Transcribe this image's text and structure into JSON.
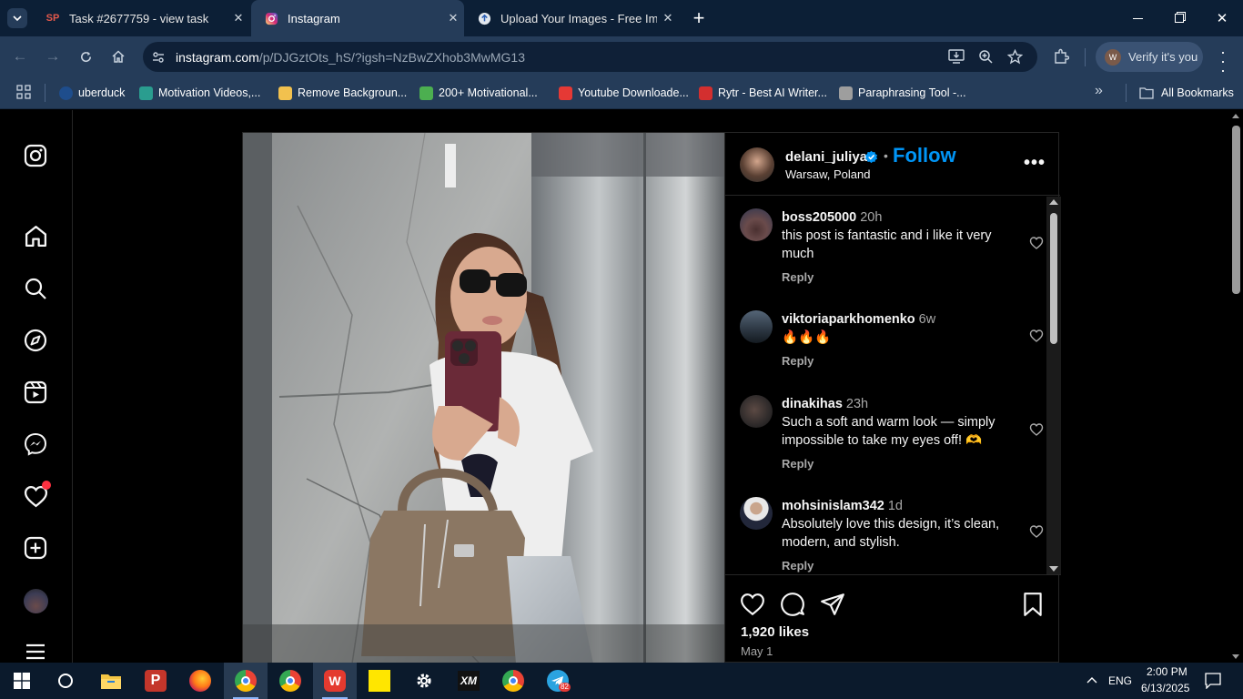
{
  "browser": {
    "tabs": [
      {
        "title": "Task #2677759 - view task",
        "favicon": "SP",
        "active": false
      },
      {
        "title": "Instagram",
        "favicon": "instagram-icon",
        "active": true
      },
      {
        "title": "Upload Your Images - Free Imag",
        "favicon": "upload-icon",
        "active": false
      }
    ],
    "url_host": "instagram.com",
    "url_path": "/p/DJGztOts_hS/?igsh=NzBwZXhob3MwMG13",
    "verify_label": "Verify it's you",
    "verify_avatar": "W",
    "bookmarks": [
      {
        "label": "uberduck",
        "color": "#1e4d8c"
      },
      {
        "label": "Motivation Videos,...",
        "color": "#2a9d8f"
      },
      {
        "label": "Remove Backgroun...",
        "color": "#f2c14e"
      },
      {
        "label": "200+ Motivational...",
        "color": "#4caf50"
      },
      {
        "label": "Youtube Downloade...",
        "color": "#e53935"
      },
      {
        "label": "Rytr - Best AI Writer...",
        "color": "#d32f2f"
      },
      {
        "label": "Paraphrasing Tool -...",
        "color": "#9e9e9e"
      }
    ],
    "all_bookmarks": "All Bookmarks"
  },
  "post": {
    "username": "delani_juliya",
    "follow_label": "Follow",
    "location": "Warsaw, Poland",
    "comments": [
      {
        "user": "boss205000",
        "time": "20h",
        "text": "this post is fantastic and i like it very much",
        "reply": "Reply",
        "avatar_color": "#6a4b4b"
      },
      {
        "user": "viktoriaparkhomenko",
        "time": "6w",
        "text": "🔥🔥🔥",
        "reply": "Reply",
        "avatar_color": "#3d4a5a"
      },
      {
        "user": "dinakihas",
        "time": "23h",
        "text": "Such a soft and warm look — simply impossible to take my eyes off! 🫶",
        "reply": "Reply",
        "avatar_color": "#3a3a3a"
      },
      {
        "user": "mohsinislam342",
        "time": "1d",
        "text": "Absolutely love this design, it’s clean, modern, and stylish.",
        "reply": "Reply",
        "avatar_color": "#e8e8e8"
      }
    ],
    "likes": "1,920 likes",
    "date": "May 1"
  },
  "taskbar": {
    "lang": "ENG",
    "time": "2:00 PM",
    "date": "6/13/2025",
    "telegram_badge": "82"
  },
  "colors": {
    "follow": "#0095f6",
    "browser_frame": "#253c59",
    "notification_dot": "#ff3040"
  }
}
